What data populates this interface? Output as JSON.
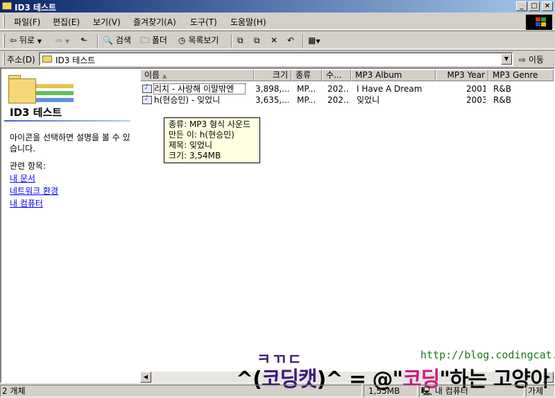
{
  "window": {
    "title": "ID3 테스트",
    "controls": [
      "_",
      "□",
      "×"
    ]
  },
  "menubar": {
    "items": [
      "파일(F)",
      "편집(E)",
      "보기(V)",
      "즐겨찾기(A)",
      "도구(T)",
      "도움말(H)"
    ]
  },
  "toolbar": {
    "back": "뒤로",
    "search": "검색",
    "folders": "폴더",
    "history": "목록보기"
  },
  "address": {
    "label": "주소(D)",
    "value": "ID3 테스트",
    "go": "이동"
  },
  "left_pane": {
    "title": "ID3 테스트",
    "description": "아이콘을 선택하면 설명을 볼 수 있습니다.",
    "related_heading": "관련 항목:",
    "links": [
      "내 문서",
      "네트워크 환경",
      "내 컴퓨터"
    ]
  },
  "columns": [
    "이름",
    "크기",
    "종류",
    "수...",
    "MP3 Album",
    "MP3 Year",
    "MP3 Genre"
  ],
  "files": [
    {
      "name": "리치 - 사랑해 이말밖엔",
      "size": "3,898,...",
      "type": "MP...",
      "modified": "202...",
      "album": "I Have A Dream",
      "year": "2001",
      "genre": "R&B"
    },
    {
      "name": "h(현승민) - 잊었니",
      "size": "3,635,...",
      "type": "MP...",
      "modified": "202...",
      "album": "잊었니",
      "year": "2003",
      "genre": "R&B"
    }
  ],
  "tooltip": {
    "type": "종류: MP3 형식 사운드",
    "artist": "만든 이: h(현승민)",
    "title": "제목: 잊었니",
    "size": "크기: 3,54MB"
  },
  "watermark": {
    "url": "http://blog.codingcat.kr/",
    "logo": "ㅋㄲㄷ",
    "brand_left": "^(",
    "brand_cat": "코딩캣",
    "brand_mid": ")^ = @\"",
    "brand_coding": "코딩",
    "brand_rest": "\"하는 고양이"
  },
  "status": {
    "count": "2 개체",
    "size": "1,55MB",
    "location": "내 컴퓨터",
    "extra": "가제"
  },
  "colors": {
    "title_start": "#0a246a",
    "title_end": "#a6caf0",
    "link": "#0000ff",
    "tooltip_bg": "#ffffe1"
  }
}
